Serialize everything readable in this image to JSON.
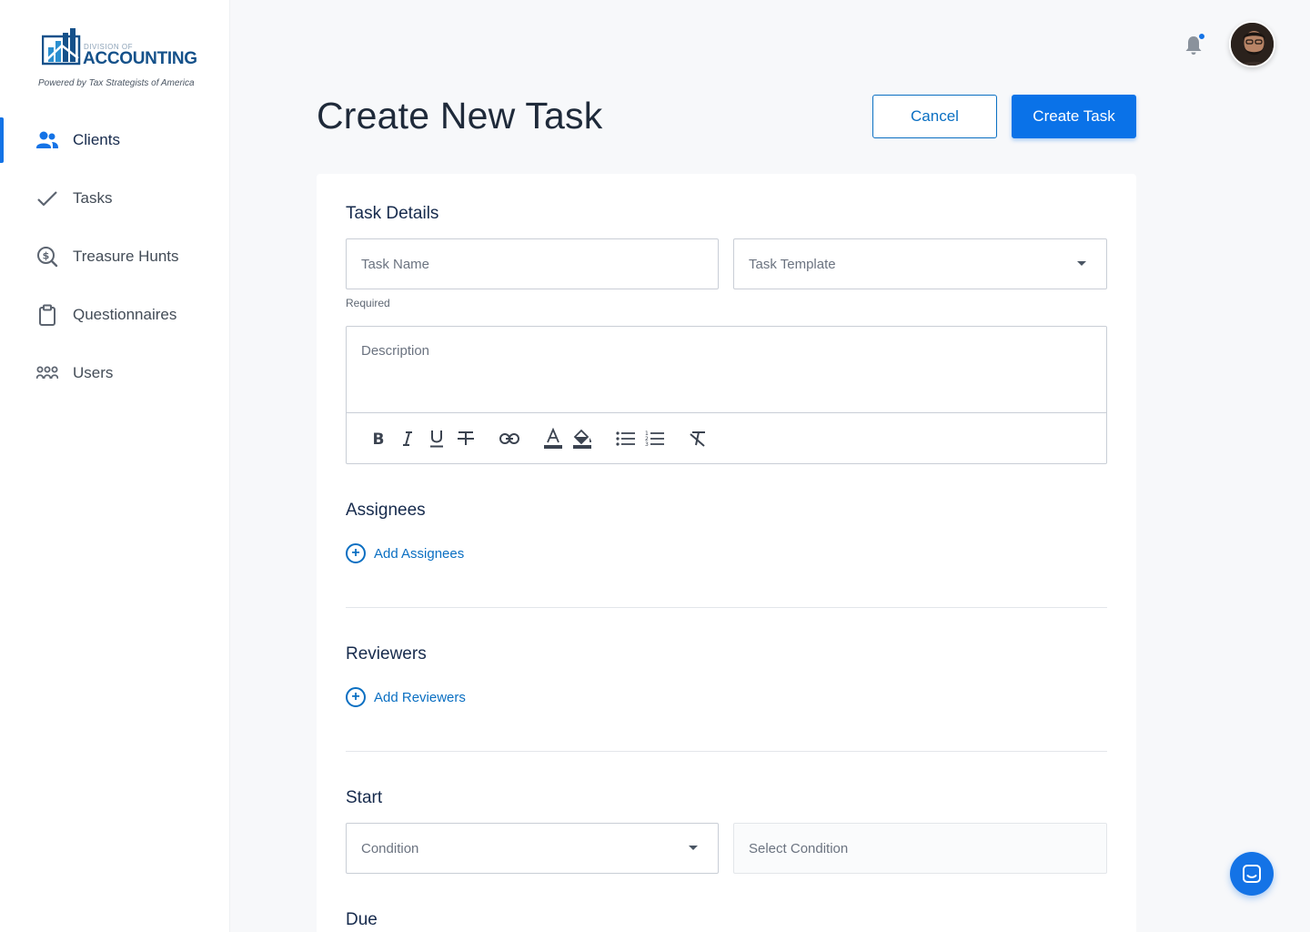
{
  "brand": {
    "division": "Division of",
    "name": "ACCOUNTING",
    "tagline": "Powered by Tax Strategists of America"
  },
  "sidebar": {
    "items": [
      {
        "label": "Clients",
        "icon": "users-icon",
        "active": true
      },
      {
        "label": "Tasks",
        "icon": "check-icon",
        "active": false
      },
      {
        "label": "Treasure Hunts",
        "icon": "dollar-search-icon",
        "active": false
      },
      {
        "label": "Questionnaires",
        "icon": "clipboard-icon",
        "active": false
      },
      {
        "label": "Users",
        "icon": "group-icon",
        "active": false
      }
    ]
  },
  "header": {
    "title": "Create New Task",
    "cancel_label": "Cancel",
    "create_label": "Create Task"
  },
  "form": {
    "task_details": {
      "title": "Task Details",
      "task_name_placeholder": "Task Name",
      "task_name_helper": "Required",
      "task_template_placeholder": "Task Template",
      "description_placeholder": "Description"
    },
    "assignees": {
      "title": "Assignees",
      "add_label": "Add Assignees"
    },
    "reviewers": {
      "title": "Reviewers",
      "add_label": "Add Reviewers"
    },
    "start": {
      "title": "Start",
      "condition_placeholder": "Condition",
      "select_condition_placeholder": "Select Condition"
    },
    "due": {
      "title": "Due"
    }
  },
  "colors": {
    "accent": "#0a72e8",
    "link": "#0a6fc2",
    "brand": "#15518a"
  },
  "notifications": {
    "has_unread": true
  }
}
